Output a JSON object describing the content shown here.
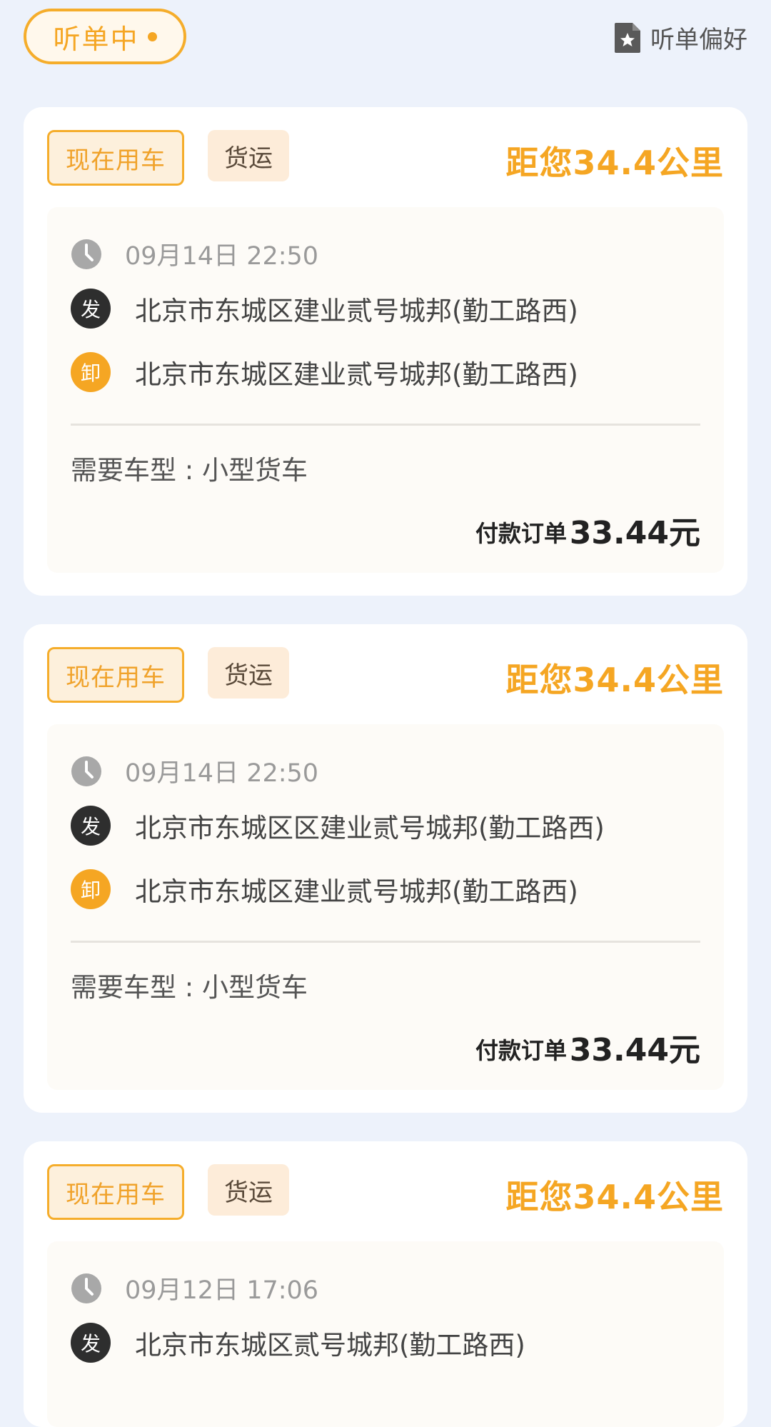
{
  "header": {
    "status_label": "听单中",
    "preference_label": "听单偏好"
  },
  "orders": [
    {
      "tag_now": "现在用车",
      "tag_type": "货运",
      "distance": "距您34.4公里",
      "time": "09月14日 22:50",
      "pickup_badge": "发",
      "pickup_address": "北京市东城区建业贰号城邦(勤工路西)",
      "dropoff_badge": "卸",
      "dropoff_address": "北京市东城区建业贰号城邦(勤工路西)",
      "vehicle": "需要车型 : 小型货车",
      "pay_label": "付款订单",
      "price": "33.44元"
    },
    {
      "tag_now": "现在用车",
      "tag_type": "货运",
      "distance": "距您34.4公里",
      "time": "09月14日 22:50",
      "pickup_badge": "发",
      "pickup_address": "北京市东城区区建业贰号城邦(勤工路西)",
      "dropoff_badge": "卸",
      "dropoff_address": "北京市东城区建业贰号城邦(勤工路西)",
      "vehicle": "需要车型 : 小型货车",
      "pay_label": "付款订单",
      "price": "33.44元"
    },
    {
      "tag_now": "现在用车",
      "tag_type": "货运",
      "distance": "距您34.4公里",
      "time": "09月12日 17:06",
      "pickup_badge": "发",
      "pickup_address": "北京市东城区贰号城邦(勤工路西)"
    }
  ],
  "icons": {
    "clock": "clock-icon",
    "preference": "document-star-icon"
  },
  "colors": {
    "accent": "#f5a623",
    "background": "#edf2fb",
    "card": "#ffffff",
    "inner_card": "#fdfbf7"
  }
}
